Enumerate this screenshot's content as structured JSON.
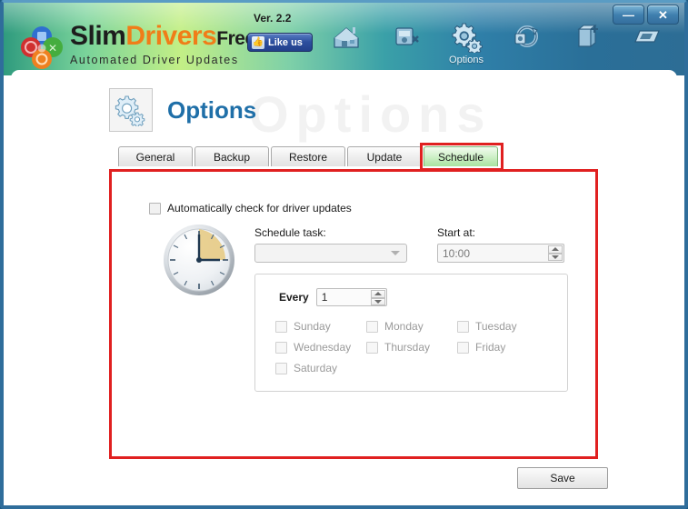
{
  "window": {
    "minimize_label": "—",
    "close_label": "✕",
    "border_color": "#2f6d9b"
  },
  "brand": {
    "name_part1": "Slim",
    "name_part2": "Drivers",
    "name_part3": "Free",
    "version": "Ver. 2.2",
    "tagline": "Automated Driver Updates",
    "logo_icon": "four-petal-flower-logo",
    "accent_color": "#f07d18"
  },
  "social": {
    "like_label": "Like us",
    "thumb_icon": "thumbs-up-icon"
  },
  "toolbar": {
    "items": [
      {
        "icon": "home-icon",
        "label": "",
        "selected": false
      },
      {
        "icon": "backup-drivers-icon",
        "label": "",
        "selected": false
      },
      {
        "icon": "gear-options-icon",
        "label": "Options",
        "selected": true
      },
      {
        "icon": "restore-sync-icon",
        "label": "",
        "selected": false
      },
      {
        "icon": "add-driver-icon",
        "label": "",
        "selected": false
      },
      {
        "icon": "license-card-icon",
        "label": "",
        "selected": false
      },
      {
        "icon": "user-account-icon",
        "label": "",
        "selected": false
      }
    ]
  },
  "page": {
    "title": "Options",
    "icon": "gear-options-icon",
    "watermark": "Options"
  },
  "tabs": [
    {
      "label": "General",
      "selected": false
    },
    {
      "label": "Backup",
      "selected": false
    },
    {
      "label": "Restore",
      "selected": false
    },
    {
      "label": "Update",
      "selected": false
    },
    {
      "label": "Schedule",
      "selected": true
    }
  ],
  "highlight": {
    "color": "#e02020",
    "targets": [
      "schedule-tab",
      "schedule-content-panel"
    ]
  },
  "schedule": {
    "auto_check": {
      "label": "Automatically check for driver updates",
      "checked": false
    },
    "clock_icon": "analog-clock-icon",
    "schedule_task": {
      "label": "Schedule task:",
      "value": "",
      "placeholder": "",
      "enabled": false
    },
    "start_at": {
      "label": "Start at:",
      "value": "10:00",
      "enabled": false
    },
    "every": {
      "label": "Every",
      "value": "1"
    },
    "days": [
      {
        "label": "Sunday",
        "checked": false,
        "enabled": false
      },
      {
        "label": "Monday",
        "checked": false,
        "enabled": false
      },
      {
        "label": "Tuesday",
        "checked": false,
        "enabled": false
      },
      {
        "label": "Wednesday",
        "checked": false,
        "enabled": false
      },
      {
        "label": "Thursday",
        "checked": false,
        "enabled": false
      },
      {
        "label": "Friday",
        "checked": false,
        "enabled": false
      },
      {
        "label": "Saturday",
        "checked": false,
        "enabled": false
      }
    ]
  },
  "footer": {
    "save_label": "Save"
  }
}
